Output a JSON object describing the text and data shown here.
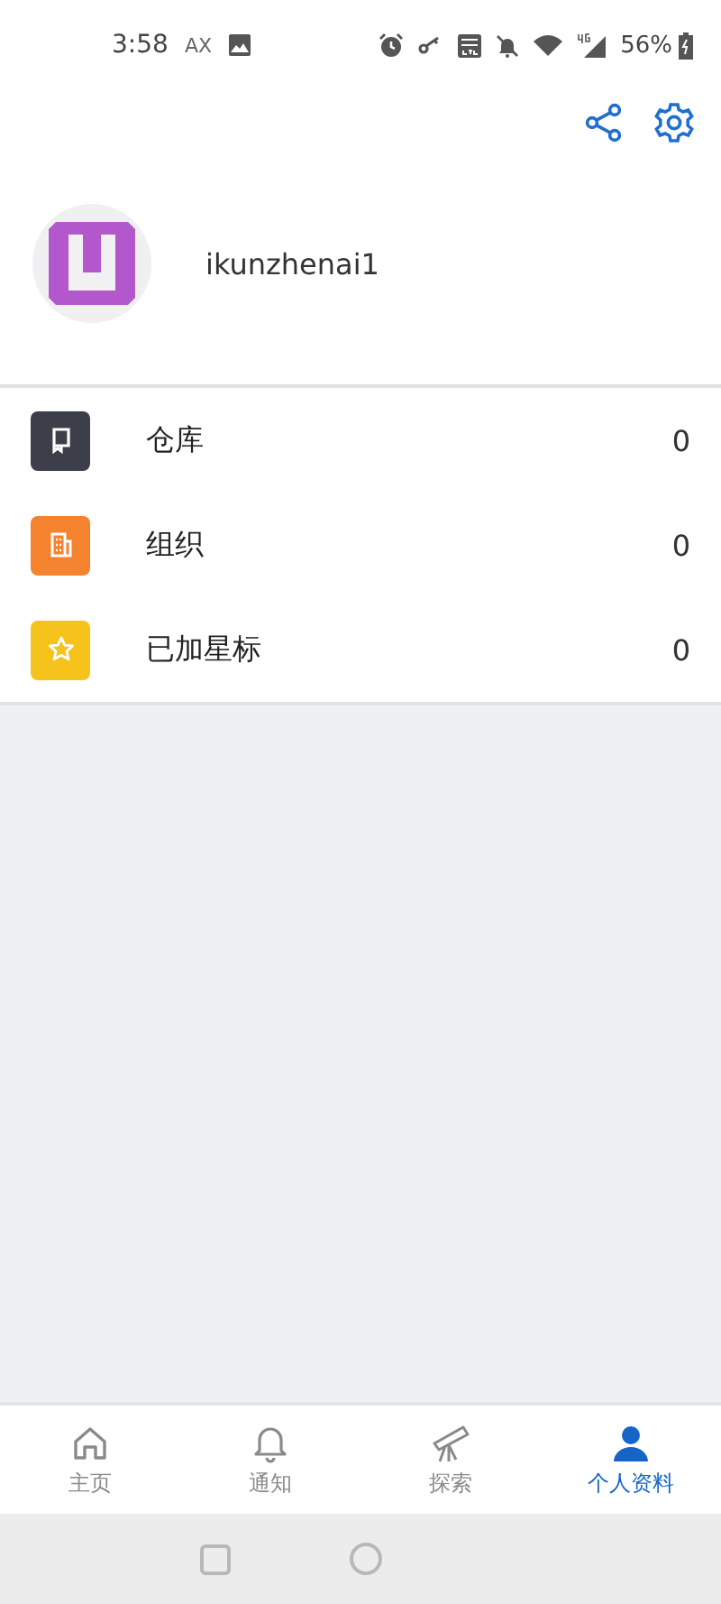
{
  "status_bar": {
    "time": "3:58",
    "carrier": "AX",
    "battery": "56%"
  },
  "toolbar": {
    "actions": [
      {
        "kind": "share"
      },
      {
        "kind": "settings"
      }
    ]
  },
  "profile": {
    "username": "ikunzhenai1"
  },
  "menu": [
    {
      "kind": "repo",
      "label": "仓库",
      "count": "0",
      "color": "#3c3e4a"
    },
    {
      "kind": "org",
      "label": "组织",
      "count": "0",
      "color": "#f5822f"
    },
    {
      "kind": "star",
      "label": "已加星标",
      "count": "0",
      "color": "#f6c21c"
    }
  ],
  "tabs": [
    {
      "kind": "home",
      "label": "主页",
      "selected": false
    },
    {
      "kind": "bell",
      "label": "通知",
      "selected": false
    },
    {
      "kind": "telescope",
      "label": "探索",
      "selected": false
    },
    {
      "kind": "person",
      "label": "个人资料",
      "selected": true
    }
  ]
}
